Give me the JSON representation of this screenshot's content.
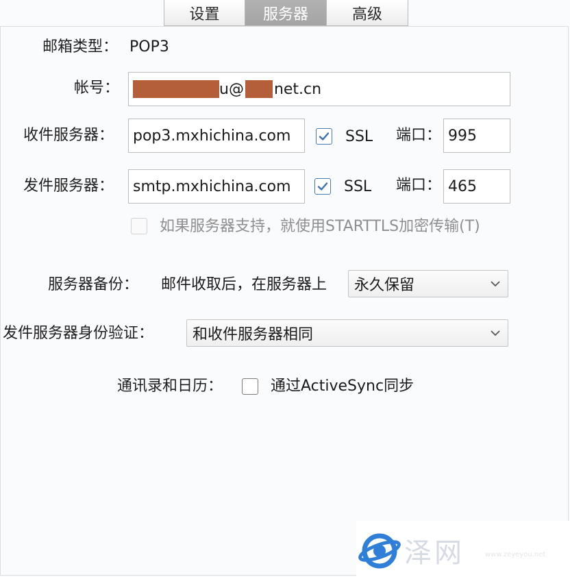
{
  "tabs": [
    {
      "label": "设置",
      "active": false
    },
    {
      "label": "服务器",
      "active": true
    },
    {
      "label": "高级",
      "active": false
    }
  ],
  "mailbox_type": {
    "label": "邮箱类型：",
    "value": "POP3"
  },
  "account": {
    "label": "帐号：",
    "visible_fragment_1": "u@",
    "visible_fragment_2": "net.cn"
  },
  "incoming": {
    "label": "收件服务器：",
    "server": "pop3.mxhichina.com",
    "ssl_label": "SSL",
    "ssl_checked": true,
    "port_label": "端口：",
    "port": "995"
  },
  "outgoing": {
    "label": "发件服务器：",
    "server": "smtp.mxhichina.com",
    "ssl_label": "SSL",
    "ssl_checked": true,
    "port_label": "端口：",
    "port": "465"
  },
  "starttls": {
    "label": "如果服务器支持，就使用STARTTLS加密传输(T)",
    "checked": false,
    "enabled": false
  },
  "backup": {
    "label": "服务器备份：",
    "prefix": "邮件收取后，在服务器上",
    "selected": "永久保留"
  },
  "smtp_auth": {
    "label": "发件服务器身份验证：",
    "selected": "和收件服务器相同"
  },
  "contacts": {
    "label": "通讯录和日历：",
    "checkbox_label": "通过ActiveSync同步",
    "checked": false
  },
  "watermark": {
    "text": "泽网",
    "url": "www.zeyeyou.net"
  },
  "colors": {
    "accent": "#4a78b0",
    "redaction": "#b45f3a",
    "active_tab": "#aaaaaa"
  }
}
